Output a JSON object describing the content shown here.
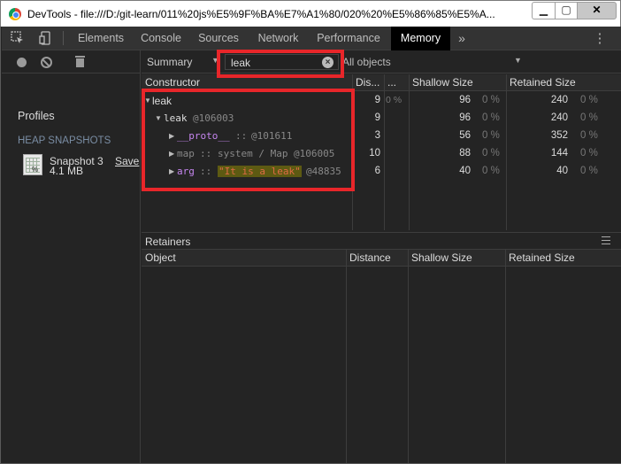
{
  "window": {
    "title": "DevTools - file:///D:/git-learn/011%20js%E5%9F%BA%E7%A1%80/020%20%E5%86%85%E5%A...",
    "minimize_glyph": "▁",
    "maximize_glyph": "▢",
    "close_glyph": "✕"
  },
  "toolbar": {
    "tabs": [
      "Elements",
      "Console",
      "Sources",
      "Network",
      "Performance",
      "Memory"
    ],
    "active_tab": "Memory",
    "overflow_glyph": "»",
    "menu_glyph": "⋮"
  },
  "sidebar": {
    "profiles_label": "Profiles",
    "section_label": "HEAP SNAPSHOTS",
    "snapshot": {
      "name": "Snapshot 3",
      "size": "4.1 MB",
      "save_label": "Save",
      "icon_pct": "%"
    }
  },
  "main_toolbar": {
    "view": "Summary",
    "filter_value": "leak",
    "clear_glyph": "×",
    "objects_filter": "All objects"
  },
  "constructor_grid": {
    "headers": [
      "Constructor",
      "Dis...",
      "...",
      "Shallow Size",
      "Retained Size"
    ],
    "rows": [
      {
        "arrow": "▼",
        "name": "leak",
        "id": "",
        "distance": "9",
        "count_pct": "0 %",
        "shallow": "96",
        "shallow_pct": "0 %",
        "retained": "240",
        "retained_pct": "0 %"
      },
      {
        "arrow": "▼",
        "name": "leak",
        "id": "@106003",
        "distance": "9",
        "shallow": "96",
        "shallow_pct": "0 %",
        "retained": "240",
        "retained_pct": "0 %"
      },
      {
        "arrow": "▶",
        "name": "__proto__",
        "sep": "::",
        "id": "@101611",
        "distance": "3",
        "shallow": "56",
        "shallow_pct": "0 %",
        "retained": "352",
        "retained_pct": "0 %"
      },
      {
        "arrow": "▶",
        "name": "map",
        "sep": "::",
        "detail": "system / Map",
        "id": "@106005",
        "distance": "10",
        "shallow": "88",
        "shallow_pct": "0 %",
        "retained": "144",
        "retained_pct": "0 %"
      },
      {
        "arrow": "▶",
        "name": "arg",
        "sep": "::",
        "detail": "\"It is a leak\"",
        "id": "@48835",
        "distance": "6",
        "shallow": "40",
        "shallow_pct": "0 %",
        "retained": "40",
        "retained_pct": "0 %"
      }
    ]
  },
  "retainers": {
    "label": "Retainers",
    "headers": [
      "Object",
      "Distance",
      "Shallow Size",
      "Retained Size"
    ]
  },
  "colors": {
    "annotation_red": "#e8262a",
    "panel_bg": "#242424",
    "active_tab_bg": "#000000",
    "string_highlight": "#5d5a12"
  }
}
